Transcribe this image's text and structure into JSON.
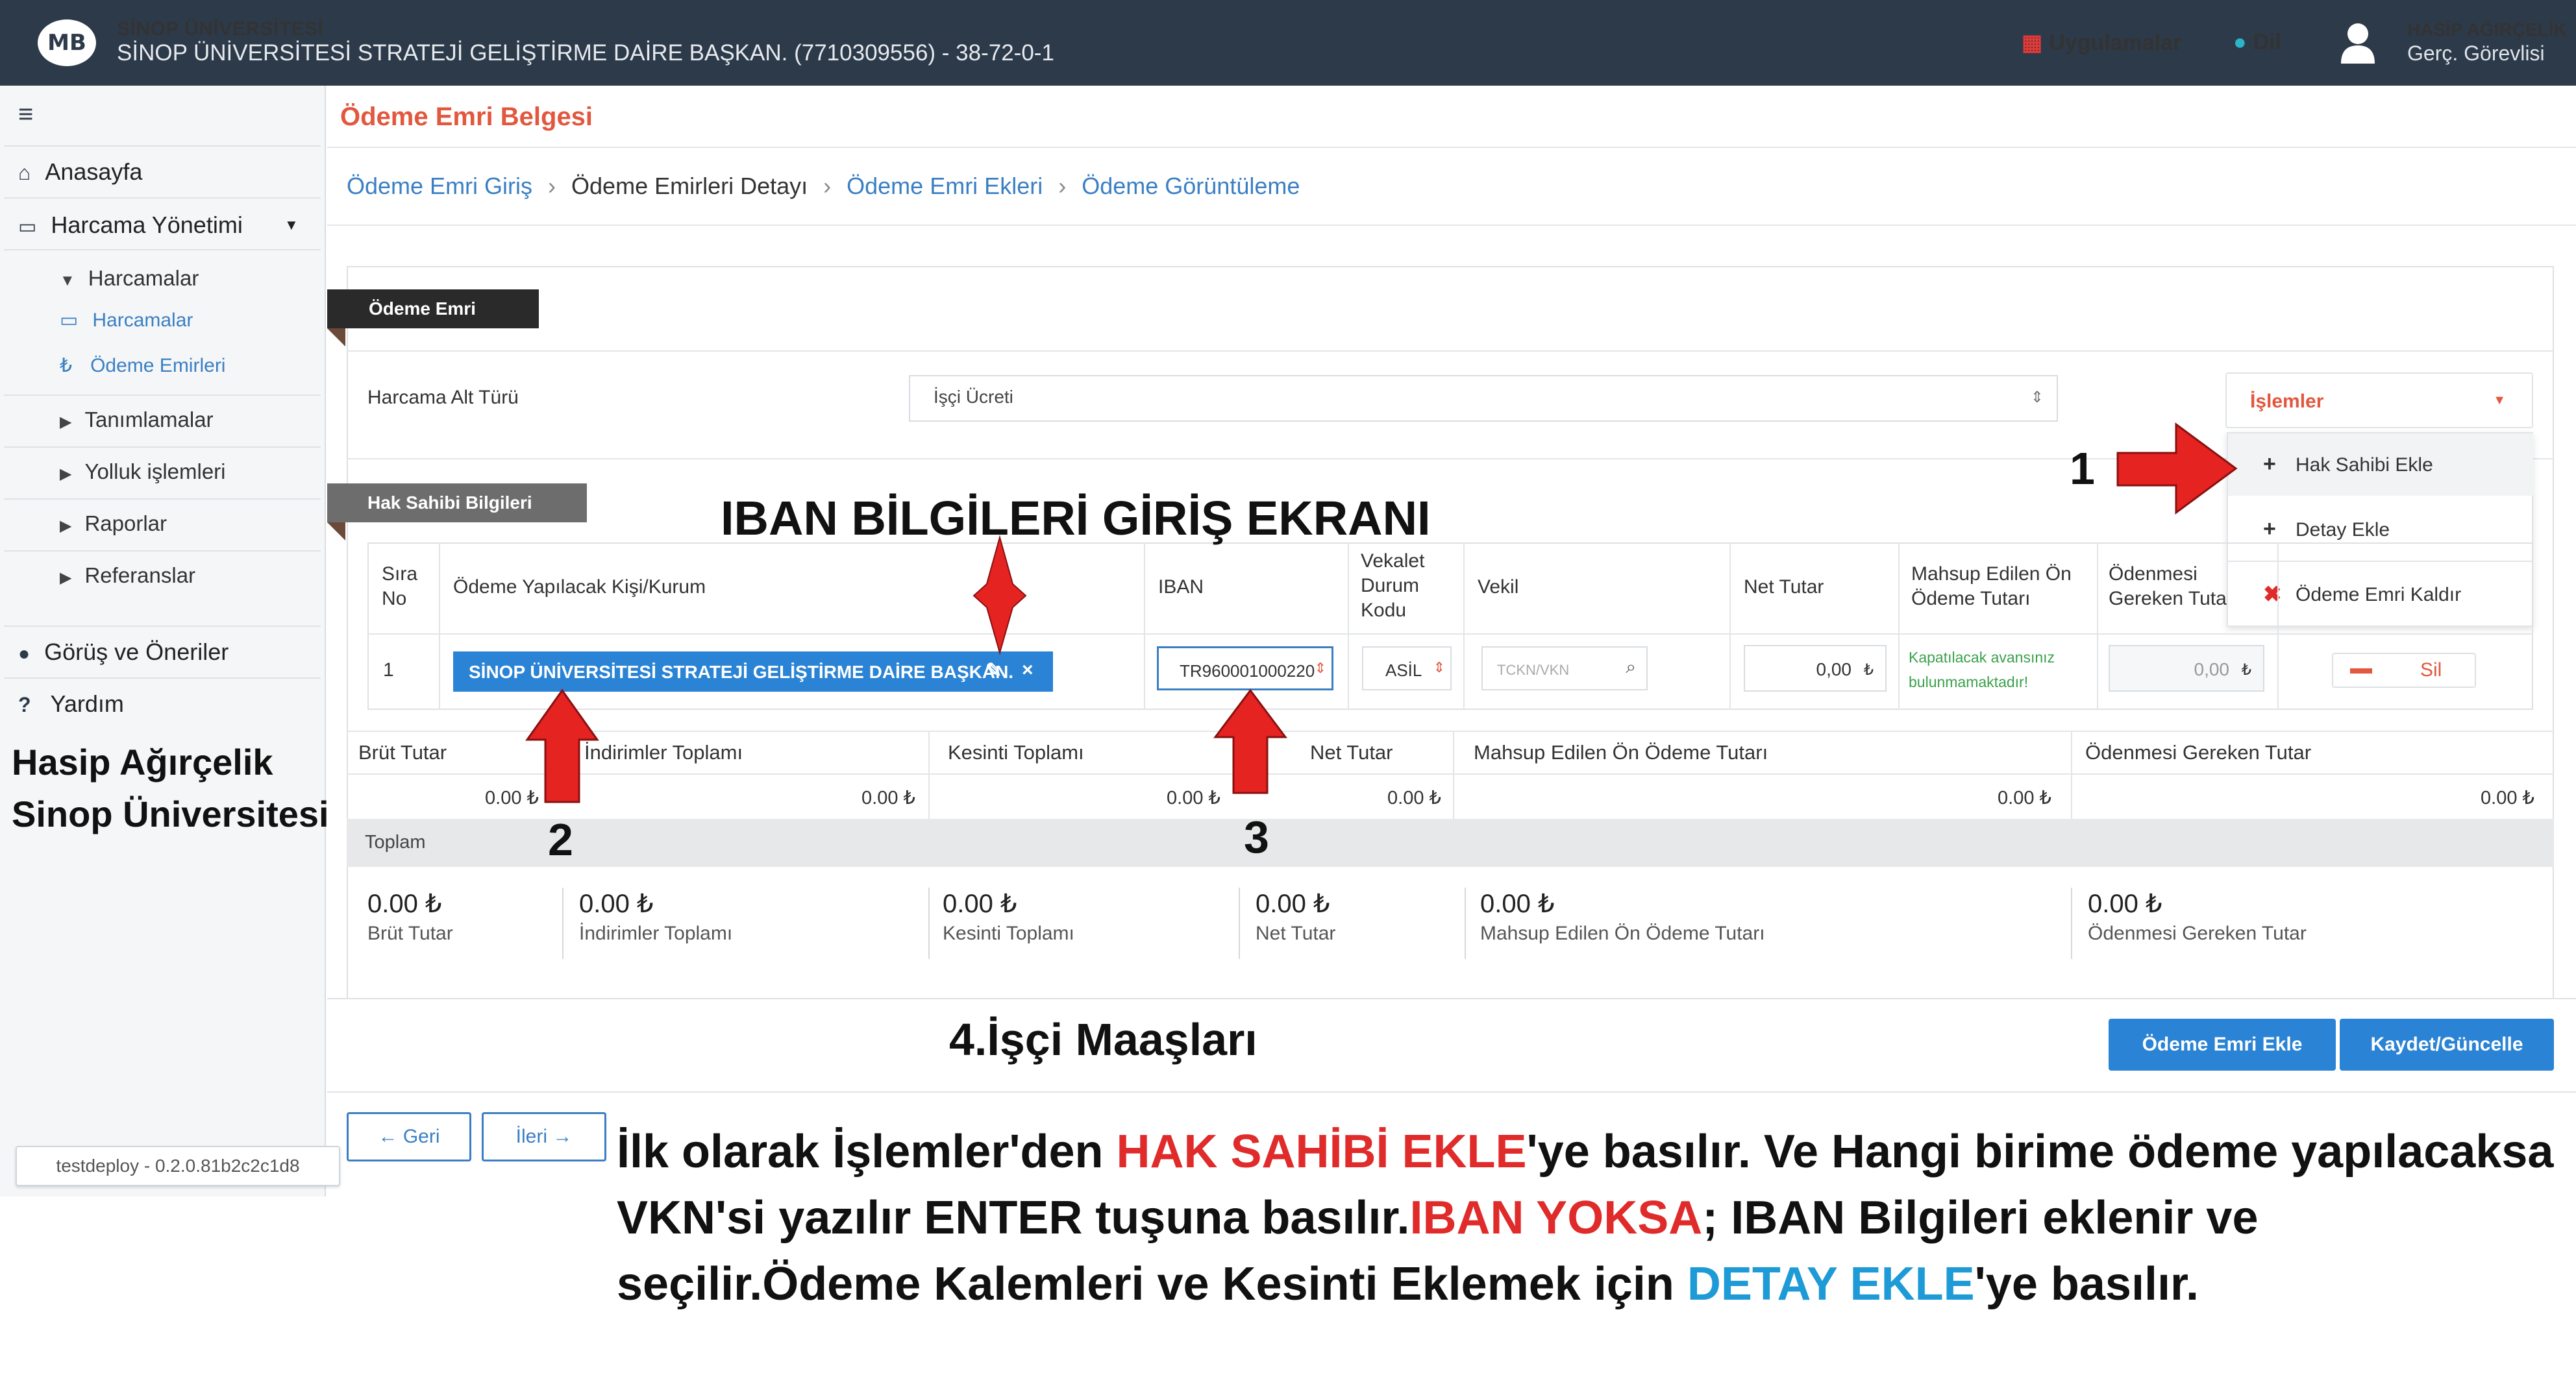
{
  "header": {
    "logo_text": "MB",
    "university": "SİNOP ÜNİVERSİTESİ",
    "unit": "SİNOP ÜNİVERSİTESİ STRATEJİ GELİŞTİRME DAİRE BAŞKAN. (7710309556) - 38-72-0-1",
    "apps_label": "Uygulamalar",
    "lang_label": "Dil",
    "user_name": "HASİP AĞIRÇELİK",
    "user_title": "Gerç. Görevlisi"
  },
  "sidebar": {
    "items": [
      {
        "label": "Anasayfa",
        "icon": "home-icon"
      },
      {
        "label": "Harcama Yönetimi",
        "icon": "credit-card-icon"
      },
      {
        "label": "Harcamalar"
      },
      {
        "label": "Harcamalar",
        "icon": "credit-card-icon"
      },
      {
        "label": "Ödeme Emirleri",
        "icon": "lira-icon"
      },
      {
        "label": "Tanımlamalar"
      },
      {
        "label": "Yolluk işlemleri"
      },
      {
        "label": "Raporlar"
      },
      {
        "label": "Referanslar"
      },
      {
        "label": "Görüş ve Öneriler",
        "icon": "comment-icon"
      },
      {
        "label": "Yardım",
        "icon": "question-icon"
      }
    ],
    "author_name": "Hasip Ağırçelik",
    "author_org": "Sinop Üniversitesi",
    "version": "testdeploy - 0.2.0.81b2c2c1d8"
  },
  "page": {
    "title": "Ödeme Emri Belgesi",
    "breadcrumb": [
      "Ödeme Emri Giriş",
      "Ödeme Emirleri Detayı",
      "Ödeme Emri Ekleri",
      "Ödeme Görüntüleme"
    ]
  },
  "form": {
    "section1": "Ödeme Emri",
    "harcama_label": "Harcama Alt Türü",
    "harcama_value": "İşçi Ücreti",
    "islemler_label": "İşlemler",
    "menu": [
      {
        "label": "Hak Sahibi Ekle",
        "icon": "plus-icon"
      },
      {
        "label": "Detay Ekle",
        "icon": "plus-icon"
      },
      {
        "label": "Ödeme Emri Kaldır",
        "icon": "times-icon"
      }
    ],
    "section2": "Hak Sahibi Bilgileri"
  },
  "hak_table": {
    "headers": [
      "Sıra\nNo",
      "Ödeme Yapılacak Kişi/Kurum",
      "IBAN",
      "Vekalet\nDurum\nKodu",
      "Vekil",
      "Net Tutar",
      "Mahsup Edilen Ön\nÖdeme Tutarı",
      "Ödenmesi\nGereken Tuta"
    ],
    "row": {
      "no": "1",
      "payee": "SİNOP ÜNİVERSİTESİ STRATEJİ GELİŞTİRME DAİRE BAŞKAN.",
      "iban": "TR960001000220",
      "vekalet": "ASİL",
      "vekil_placeholder": "TCKN/VKN",
      "net_tutar": "0,00",
      "mahsup_text": "Kapatılacak avansınız\nbulunmamaktadır!",
      "odenmesi": "0,00",
      "delete_label": "Sil"
    }
  },
  "summary": {
    "headers": [
      "Brüt Tutar",
      "İndirimler Toplamı",
      "Kesinti Toplamı",
      "Net Tutar",
      "Mahsup Edilen Ön Ödeme Tutarı",
      "Ödenmesi Gereken Tutar"
    ],
    "values": [
      "0.00 ₺",
      "0.00 ₺",
      "0.00 ₺",
      "0.00 ₺",
      "0.00 ₺",
      "0.00 ₺"
    ],
    "toplam_label": "Toplam",
    "totals": [
      {
        "value": "0.00 ₺",
        "label": "Brüt Tutar"
      },
      {
        "value": "0.00 ₺",
        "label": "İndirimler Toplamı"
      },
      {
        "value": "0.00 ₺",
        "label": "Kesinti Toplamı"
      },
      {
        "value": "0.00 ₺",
        "label": "Net Tutar"
      },
      {
        "value": "0.00 ₺",
        "label": "Mahsup Edilen Ön Ödeme Tutarı"
      },
      {
        "value": "0.00 ₺",
        "label": "Ödenmesi Gereken Tutar"
      }
    ]
  },
  "buttons": {
    "odeme_emri_ekle": "Ödeme Emri Ekle",
    "kaydet": "Kaydet/Güncelle",
    "geri": "Geri",
    "ileri": "İleri"
  },
  "annotations": {
    "title": "IBAN BİLGİLERİ GİRİŞ EKRANI",
    "n1": "1",
    "n2": "2",
    "n3": "3",
    "subtitle": "4.İşçi Maaşları",
    "instruction_parts": [
      "İlk olarak İşlemler'den ",
      "HAK SAHİBİ EKLE",
      "'ye basılır. Ve Hangi birime ödeme yapılacaksa VKN'si yazılır ENTER tuşuna basılır.",
      "IBAN YOKSA",
      "; IBAN Bilgileri eklenir ve seçilir.Ödeme Kalemleri  ve Kesinti Eklemek için  ",
      "DETAY EKLE",
      "'ye basılır."
    ],
    "arrow_color": "#e52321",
    "accent_red": "#e02b2b",
    "accent_blue": "#1e9ad6"
  },
  "colors": {
    "topbar": "#2d3a4a",
    "primary": "#2a83d4",
    "title_orange": "#e2583e"
  }
}
